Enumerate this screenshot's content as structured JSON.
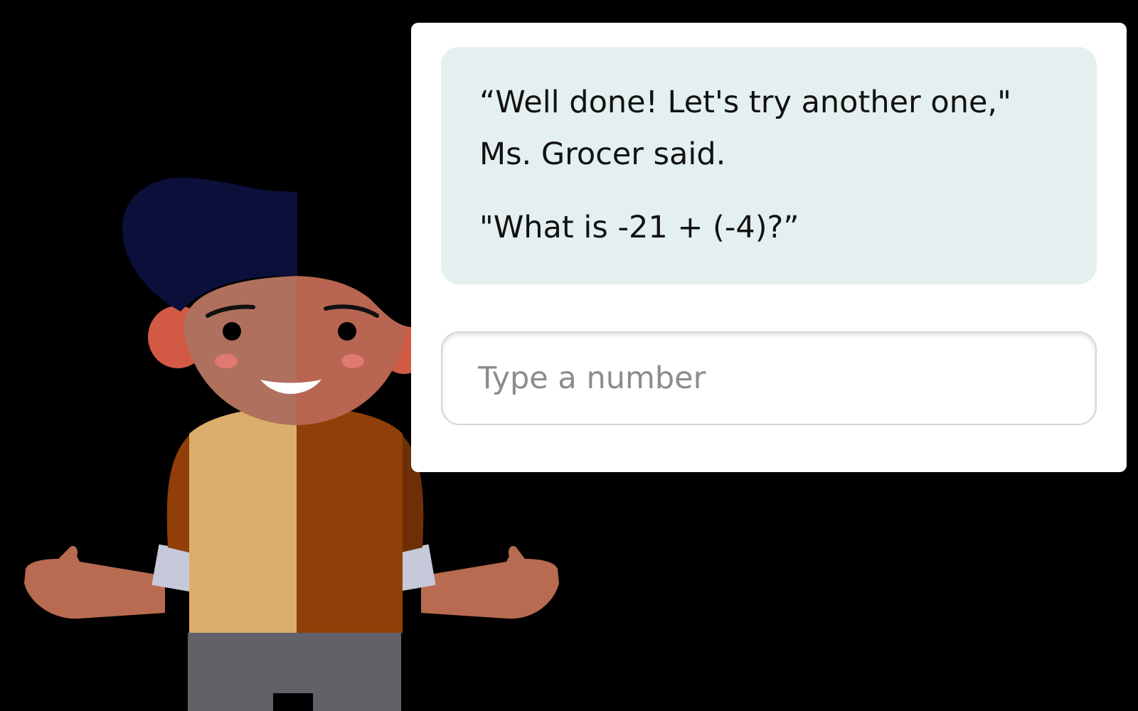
{
  "dialogue": {
    "line1": "“Well done! Let's try another one,\" Ms. Grocer said.",
    "question": "\"What is -21 + (-4)?”"
  },
  "answer": {
    "placeholder": "Type a number",
    "value": ""
  },
  "colors": {
    "speech_background": "#e4efef",
    "panel_background": "#ffffff",
    "hair": "#0b0f3a",
    "skin": "#b86b50",
    "shirt_light": "#dcae6c",
    "shirt_dark": "#8f3f07",
    "pants": "#626168"
  }
}
